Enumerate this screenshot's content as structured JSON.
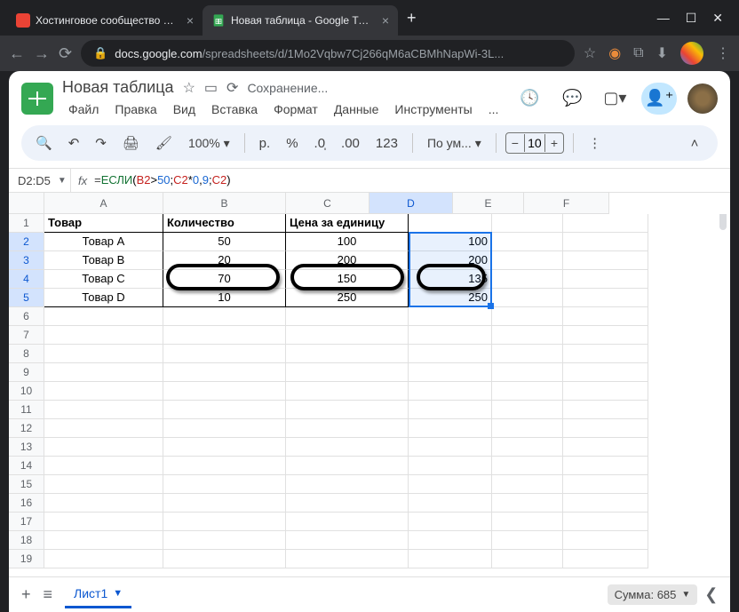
{
  "browser": {
    "tabs": [
      {
        "title": "Хостинговое сообщество «Tim",
        "favicon_color": "#ea4335"
      },
      {
        "title": "Новая таблица - Google Табли",
        "favicon": "sheets"
      }
    ],
    "url_prefix": "docs.google.com",
    "url_rest": "/spreadsheets/d/1Mo2Vqbw7Cj266qM6aCBMhNapWi-3L..."
  },
  "doc": {
    "title": "Новая таблица",
    "saving": "Сохранение..."
  },
  "menu": [
    "Файл",
    "Правка",
    "Вид",
    "Вставка",
    "Формат",
    "Данные",
    "Инструменты",
    "..."
  ],
  "toolbar": {
    "zoom": "100%",
    "currency": "р.",
    "font": "По ум...",
    "font_size": "10",
    "num_fmt": "123"
  },
  "formula": {
    "cell_ref": "D2:D5",
    "text": "=ЕСЛИ(B2>50;C2*0,9;C2)",
    "parts": {
      "func": "ЕСЛИ",
      "p1": "(",
      "b2": "B2",
      "gt": ">",
      "n50": "50",
      "sc1": ";",
      "c2a": "C2",
      "mul": "*",
      "n09": "0",
      "comma": ",",
      "n9": "9",
      "sc2": ";",
      "c2b": "C2",
      "p2": ")"
    }
  },
  "columns": [
    "A",
    "B",
    "C",
    "D",
    "E",
    "F"
  ],
  "headers": {
    "a": "Товар",
    "b": "Количество",
    "c": "Цена за единицу",
    "d": ""
  },
  "rows": [
    {
      "a": "Товар A",
      "b": "50",
      "c": "100",
      "d": "100"
    },
    {
      "a": "Товар B",
      "b": "20",
      "c": "200",
      "d": "200"
    },
    {
      "a": "Товар C",
      "b": "70",
      "c": "150",
      "d": "135"
    },
    {
      "a": "Товар D",
      "b": "10",
      "c": "250",
      "d": "250"
    }
  ],
  "sheet": {
    "name": "Лист1",
    "summary": "Сумма: 685"
  }
}
